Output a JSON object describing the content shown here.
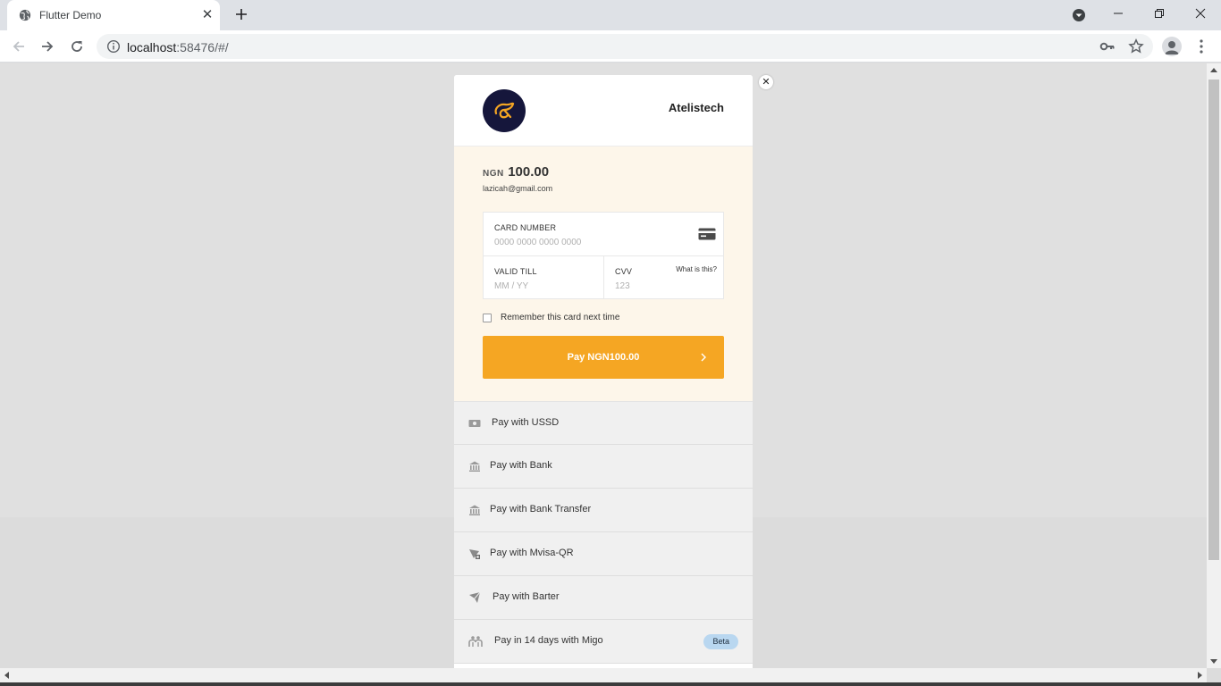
{
  "browser": {
    "tab_title": "Flutter Demo",
    "url_host": "localhost",
    "url_rest": ":58476/#/"
  },
  "checkout": {
    "merchant": "Atelistech",
    "currency": "NGN",
    "amount": "100.00",
    "email": "lazicah@gmail.com",
    "card_number_label": "CARD NUMBER",
    "card_number_placeholder": "0000 0000 0000 0000",
    "valid_till_label": "VALID TILL",
    "valid_till_placeholder": "MM / YY",
    "cvv_label": "CVV",
    "cvv_placeholder": "123",
    "what_is_this": "What is this?",
    "remember_label": "Remember this card next time",
    "pay_button": "Pay NGN100.00",
    "accent_color": "#f5a623"
  },
  "payment_options": [
    {
      "label": "Pay with USSD",
      "icon": "cash-icon"
    },
    {
      "label": "Pay with Bank",
      "icon": "bank-icon"
    },
    {
      "label": "Pay with Bank Transfer",
      "icon": "bank-icon"
    },
    {
      "label": "Pay with Mvisa-QR",
      "icon": "qr-icon"
    },
    {
      "label": "Pay with Barter",
      "icon": "barter-icon"
    },
    {
      "label": "Pay in 14 days with Migo",
      "icon": "migo-icon",
      "badge": "Beta"
    }
  ]
}
